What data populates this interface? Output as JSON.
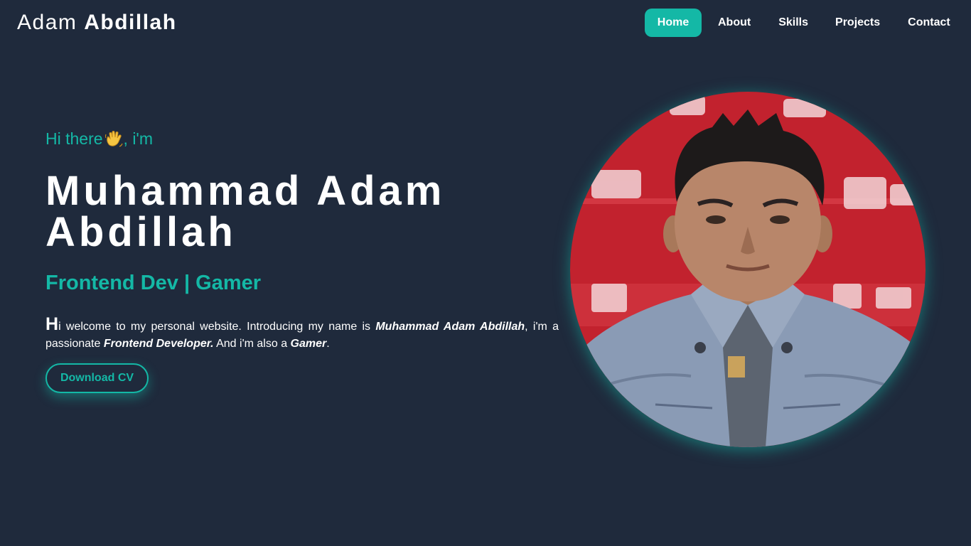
{
  "header": {
    "logo_first": "Adam",
    "logo_last": "Abdillah",
    "nav": [
      "Home",
      "About",
      "Skills",
      "Projects",
      "Contact"
    ],
    "active_nav": "Home"
  },
  "hero": {
    "greeting_before": "Hi there",
    "greeting_after": ", i'm",
    "wave_icon": "waving-hand-icon",
    "name": "Muhammad Adam Abdillah",
    "role": "Frontend Dev | Gamer",
    "intro": {
      "drop_letter": "H",
      "part1": "i welcome to my personal website. Introducing my name is ",
      "bold_name": "Muhammad Adam Abdillah",
      "part2": ", i'm a passionate ",
      "bold_role": "Frontend Developer.",
      "part3": " And i'm also a ",
      "bold_hobby": "Gamer",
      "part4": "."
    },
    "cv_button": "Download CV"
  },
  "colors": {
    "background": "#1f2a3c",
    "accent": "#14b8a6",
    "text": "#ffffff"
  }
}
